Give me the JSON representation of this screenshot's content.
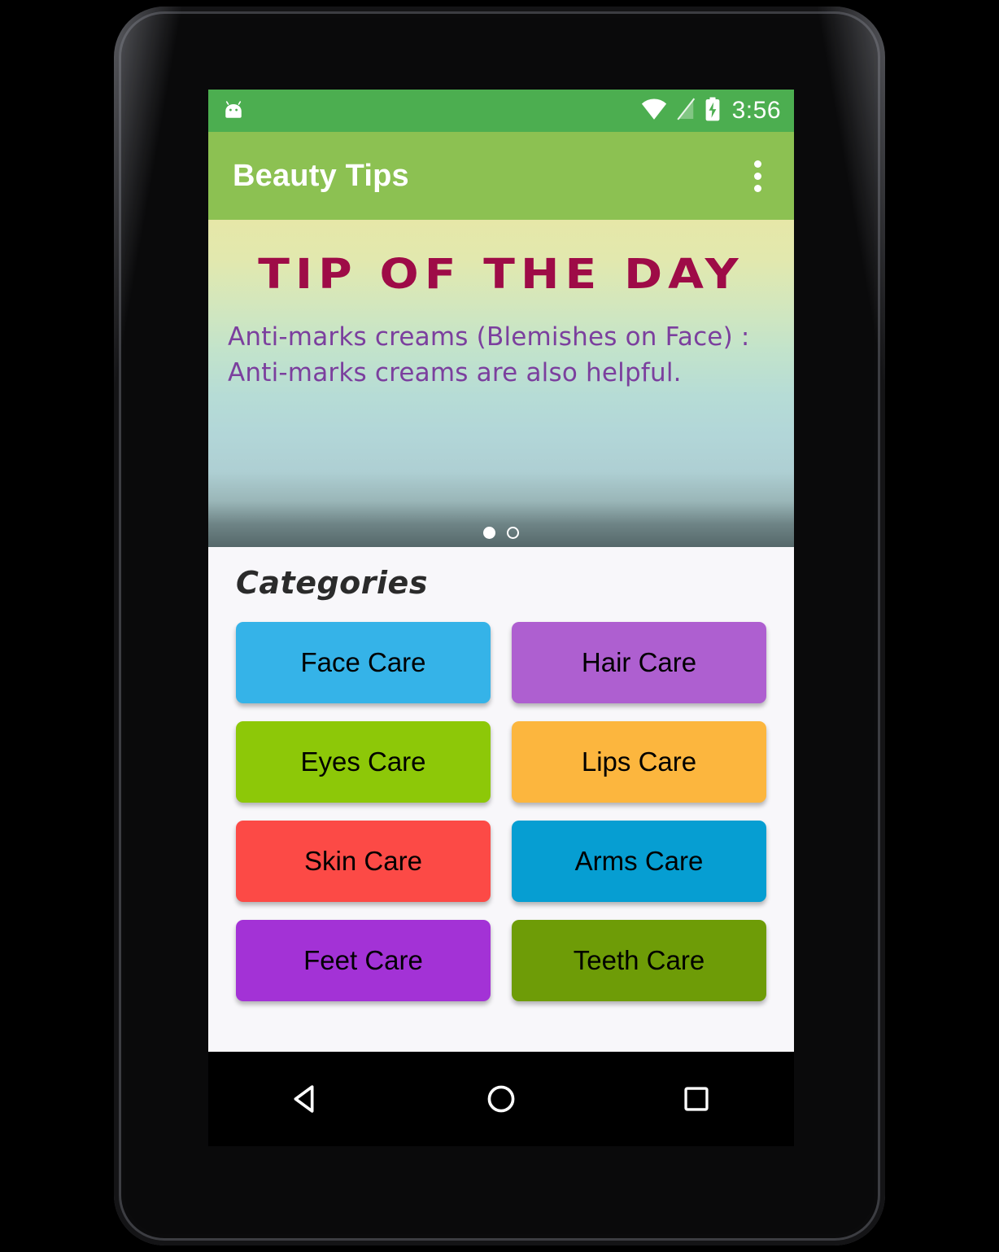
{
  "status_bar": {
    "left_icon": "android-head-icon",
    "icons": [
      "wifi-icon",
      "no-sim-signal-icon",
      "battery-charging-icon"
    ],
    "time": "3:56",
    "background": "#4cae50"
  },
  "app_bar": {
    "title": "Beauty Tips",
    "overflow_icon": "overflow-menu-icon",
    "background": "#8cc152",
    "title_color": "#ffffff"
  },
  "tip_banner": {
    "heading": "Tip of the Day",
    "body": "Anti-marks creams (Blemishes on Face) : Anti-marks creams are also helpful.",
    "heading_color": "#9e0b47",
    "body_color": "#7b3f9e",
    "page_indicator": {
      "total": 2,
      "active_index": 0
    }
  },
  "categories": {
    "title": "Categories",
    "title_color": "#2b2b2b",
    "items": [
      {
        "label": "Face Care",
        "color": "#35b3e8"
      },
      {
        "label": "Hair Care",
        "color": "#ae5fd0"
      },
      {
        "label": "Eyes Care",
        "color": "#8dc808"
      },
      {
        "label": "Lips Care",
        "color": "#fcb63e"
      },
      {
        "label": "Skin Care",
        "color": "#fc4a46"
      },
      {
        "label": "Arms Care",
        "color": "#069ed2"
      },
      {
        "label": "Feet Care",
        "color": "#a332d6"
      },
      {
        "label": "Teeth Care",
        "color": "#6e9c07"
      }
    ]
  },
  "nav_bar": {
    "back_label": "back-icon",
    "home_label": "home-icon",
    "recents_label": "recents-icon",
    "background": "#000000"
  }
}
